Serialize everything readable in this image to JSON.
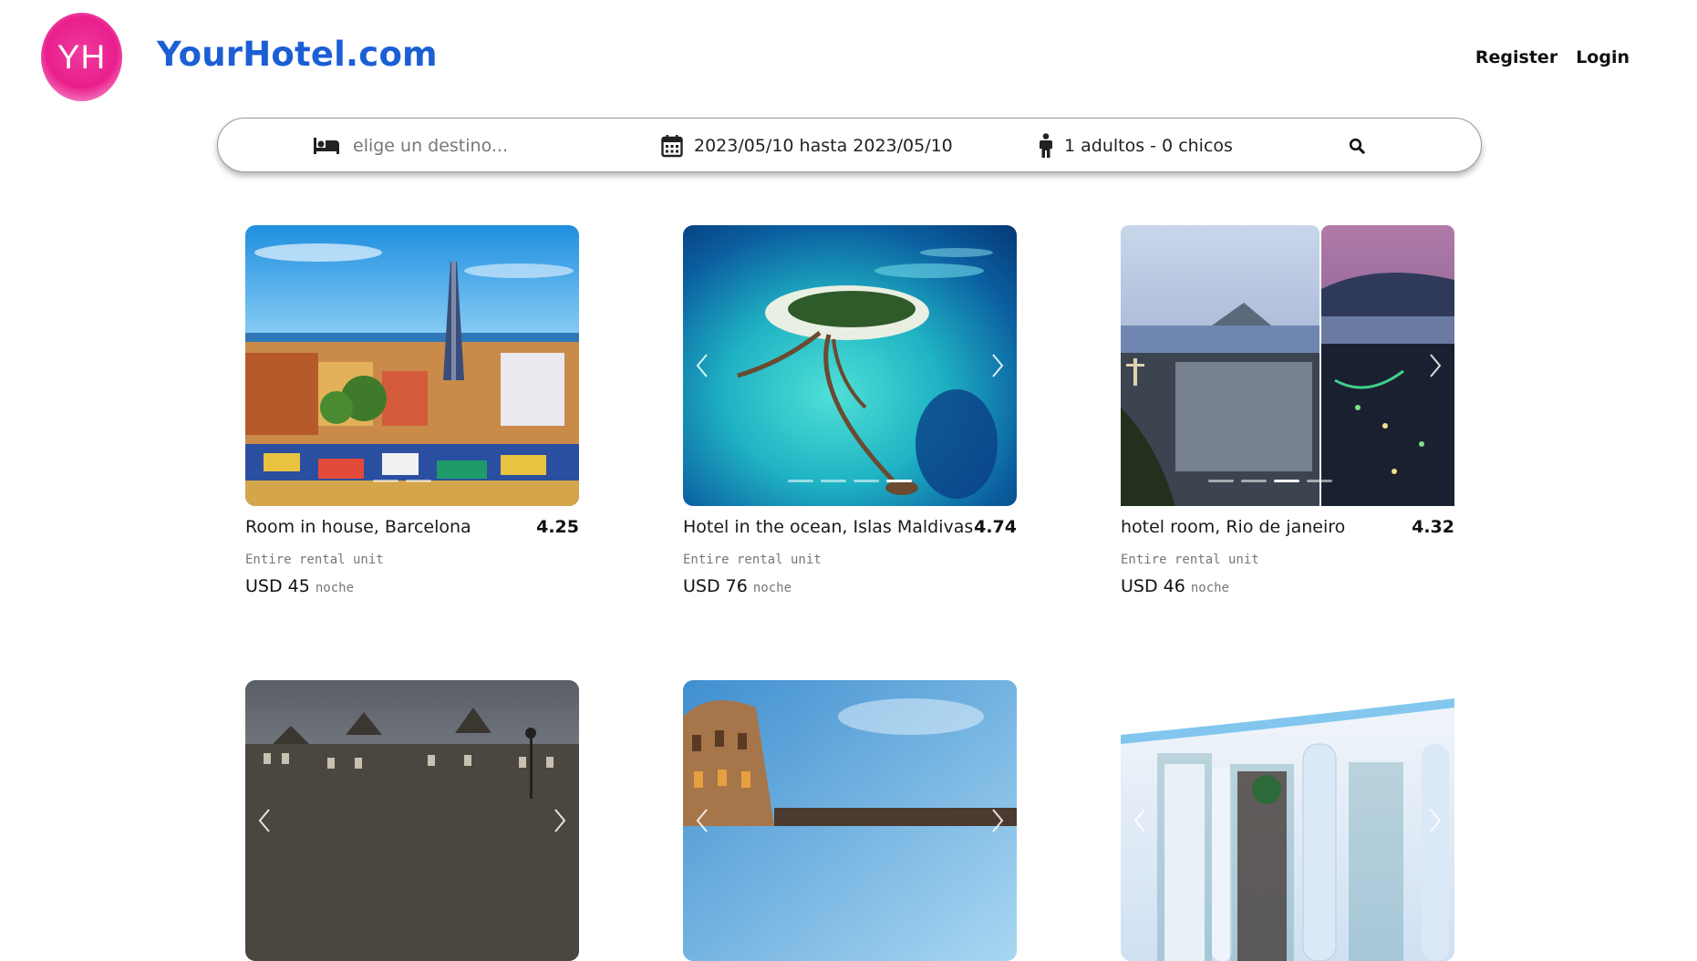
{
  "header": {
    "logo_text": "YH",
    "site_name": "YourHotel.com",
    "nav": {
      "register": "Register",
      "login": "Login"
    }
  },
  "search": {
    "destination_placeholder": "elige un destino...",
    "dates": "2023/05/10 hasta 2023/05/10",
    "guests": "1 adultos - 0 chicos",
    "icons": {
      "destination": "bed-icon",
      "dates": "calendar-icon",
      "guests": "person-icon",
      "submit": "search-icon"
    }
  },
  "listings": [
    {
      "title": "Room in house, Barcelona",
      "rating": "4.25",
      "type": "Entire rental unit",
      "price": "USD 45",
      "price_unit": "noche"
    },
    {
      "title": "Hotel in the ocean, Islas Maldivas",
      "rating": "4.74",
      "type": "Entire rental unit",
      "price": "USD 76",
      "price_unit": "noche"
    },
    {
      "title": "hotel room, Rio de janeiro",
      "rating": "4.32",
      "type": "Entire rental unit",
      "price": "USD 46",
      "price_unit": "noche"
    },
    {
      "title": "",
      "rating": "",
      "type": "",
      "price": "",
      "price_unit": ""
    },
    {
      "title": "",
      "rating": "",
      "type": "",
      "price": "",
      "price_unit": ""
    },
    {
      "title": "",
      "rating": "",
      "type": "",
      "price": "",
      "price_unit": ""
    }
  ],
  "colors": {
    "brand_blue": "#1c5fd4",
    "logo_pink": "#e91e8c",
    "text_muted": "#777777"
  }
}
